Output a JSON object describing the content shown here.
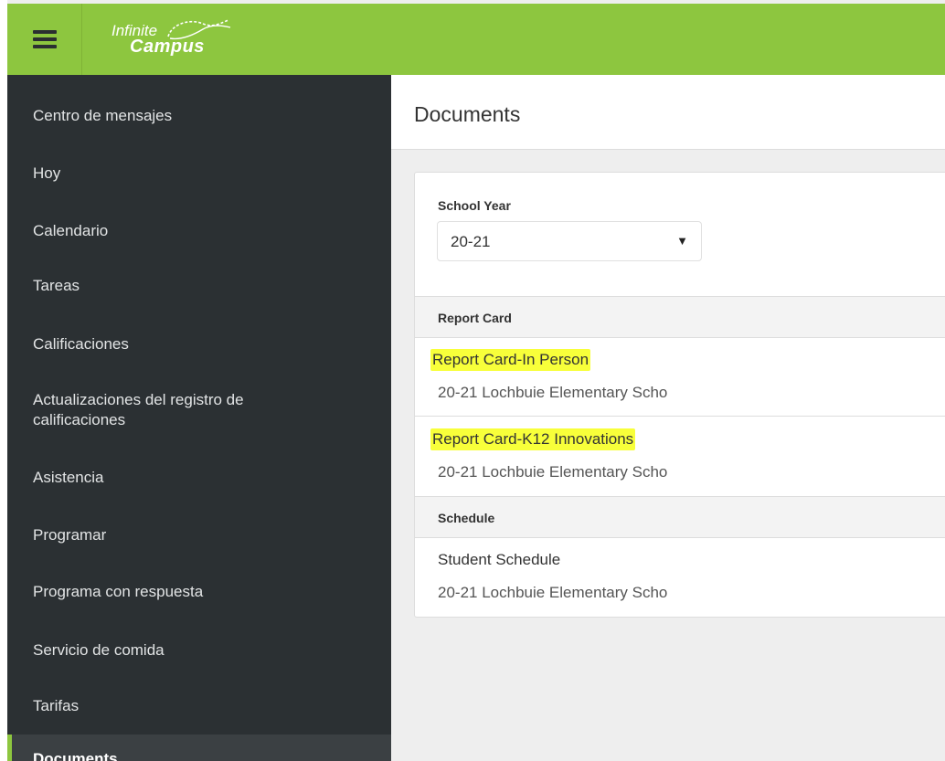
{
  "header": {
    "logo_line1": "Infinite",
    "logo_line2": "Campus",
    "brand_color": "#8dc63f"
  },
  "sidebar": {
    "items": [
      {
        "label": "Centro de mensajes"
      },
      {
        "label": "Hoy"
      },
      {
        "label": "Calendario"
      },
      {
        "label": "Tareas"
      },
      {
        "label": "Calificaciones"
      },
      {
        "label": "Actualizaciones del registro de calificaciones"
      },
      {
        "label": "Asistencia"
      },
      {
        "label": "Programar"
      },
      {
        "label": "Programa con respuesta"
      },
      {
        "label": "Servicio de comida"
      },
      {
        "label": "Tarifas"
      },
      {
        "label": "Documents",
        "active": true
      }
    ]
  },
  "main": {
    "title": "Documents",
    "school_year": {
      "label": "School Year",
      "value": "20-21"
    },
    "sections": [
      {
        "heading": "Report Card",
        "documents": [
          {
            "title": "Report Card-In Person",
            "subtitle": "20-21 Lochbuie Elementary Scho",
            "highlighted": true
          },
          {
            "title": "Report Card-K12 Innovations",
            "subtitle": "20-21 Lochbuie Elementary Scho",
            "highlighted": true
          }
        ]
      },
      {
        "heading": "Schedule",
        "documents": [
          {
            "title": "Student Schedule",
            "subtitle": "20-21 Lochbuie Elementary Scho",
            "highlighted": false
          }
        ]
      }
    ]
  },
  "colors": {
    "sidebar_bg": "#2b3033",
    "highlight": "#f8ff3a"
  }
}
